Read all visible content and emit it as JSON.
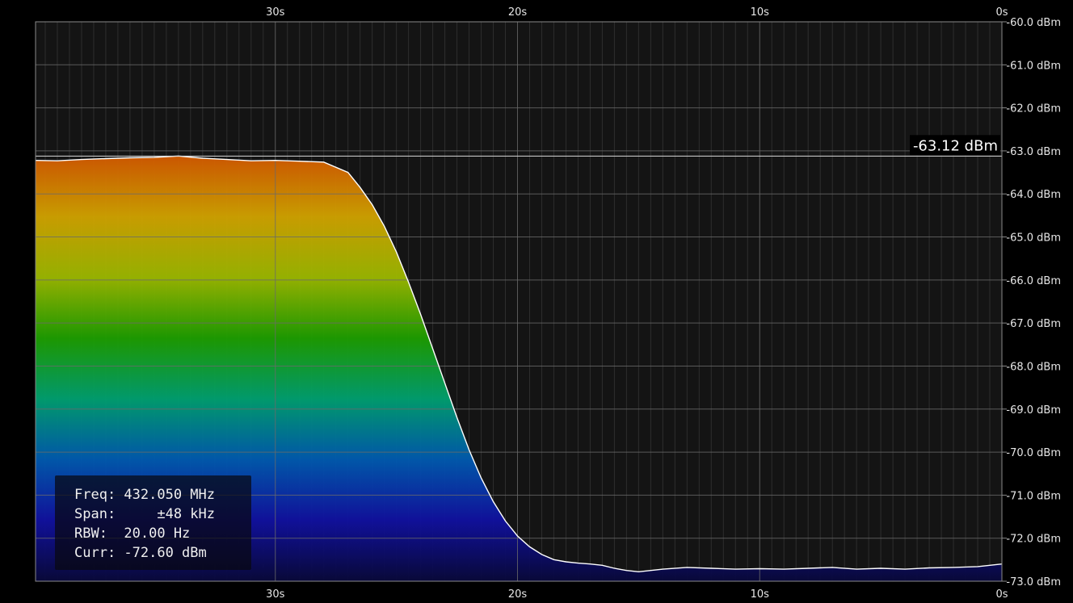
{
  "colors": {
    "background": "#000000",
    "plot_background": "#141414",
    "grid_major": "#6a6a6a",
    "grid_minor": "#2e2e2e",
    "trace": "#ffffff",
    "gradient": [
      "#d45a00",
      "#d1a300",
      "#9cb800",
      "#1d9e00",
      "#00a070",
      "#005ab0",
      "#1010a0",
      "#08083a"
    ]
  },
  "info": {
    "freq": "Freq: 432.050 MHz",
    "span": "Span:     ±48 kHz",
    "rbw": "RBW:  20.00 Hz",
    "curr": "Curr: -72.60 dBm"
  },
  "marker": {
    "label": "-63.12 dBm",
    "value": -63.12
  },
  "chart_data": {
    "type": "area",
    "title": "",
    "xlabel": "",
    "ylabel": "",
    "xlim": [
      39.9,
      0
    ],
    "ylim": [
      -73,
      -60
    ],
    "x_tick_values": [
      30,
      20,
      10,
      0
    ],
    "x_tick_labels": [
      "30s",
      "20s",
      "10s",
      "0s"
    ],
    "y_tick_values": [
      -60,
      -61,
      -62,
      -63,
      -64,
      -65,
      -66,
      -67,
      -68,
      -69,
      -70,
      -71,
      -72,
      -73
    ],
    "y_tick_labels": [
      "-60.0 dBm",
      "-61.0 dBm",
      "-62.0 dBm",
      "-63.0 dBm",
      "-64.0 dBm",
      "-65.0 dBm",
      "-66.0 dBm",
      "-67.0 dBm",
      "-68.0 dBm",
      "-69.0 dBm",
      "-70.0 dBm",
      "-71.0 dBm",
      "-72.0 dBm",
      "-73.0 dBm"
    ],
    "grid": true,
    "series": [
      {
        "x": [
          39.9,
          39,
          38,
          37,
          36,
          35,
          34,
          33,
          32,
          31,
          30,
          29,
          28,
          27,
          26.5,
          26,
          25.5,
          25,
          24.5,
          24,
          23.5,
          23,
          22.5,
          22,
          21.5,
          21,
          20.5,
          20,
          19.5,
          19,
          18.5,
          18,
          17.5,
          17,
          16.5,
          16,
          15.5,
          15,
          14,
          13,
          12,
          11,
          10,
          9,
          8,
          7,
          6,
          5,
          4,
          3,
          2,
          1,
          0
        ],
        "y": [
          -63.22,
          -63.23,
          -63.2,
          -63.18,
          -63.16,
          -63.15,
          -63.12,
          -63.17,
          -63.2,
          -63.23,
          -63.22,
          -63.24,
          -63.26,
          -63.5,
          -63.85,
          -64.25,
          -64.75,
          -65.35,
          -66.05,
          -66.8,
          -67.6,
          -68.4,
          -69.2,
          -69.95,
          -70.6,
          -71.15,
          -71.6,
          -71.95,
          -72.2,
          -72.38,
          -72.5,
          -72.55,
          -72.58,
          -72.6,
          -72.63,
          -72.7,
          -72.75,
          -72.78,
          -72.72,
          -72.68,
          -72.7,
          -72.72,
          -72.71,
          -72.72,
          -72.7,
          -72.68,
          -72.72,
          -72.7,
          -72.72,
          -72.69,
          -72.68,
          -72.66,
          -72.6
        ]
      }
    ]
  }
}
